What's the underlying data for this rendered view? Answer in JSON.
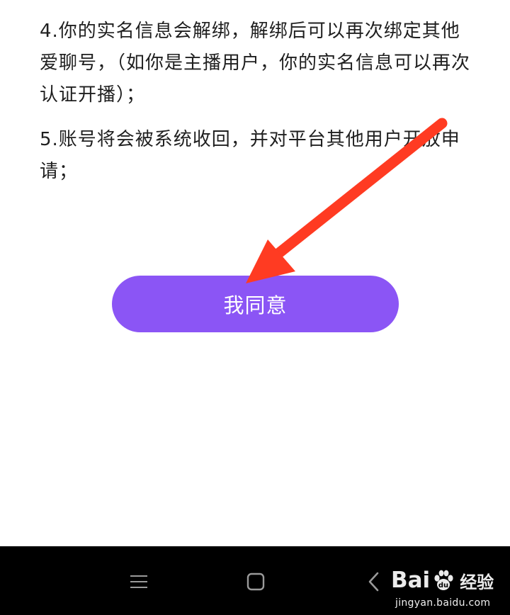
{
  "terms": {
    "item4": "4.你的实名信息会解绑，解绑后可以再次绑定其他爱聊号，（如你是主播用户，你的实名信息可以再次认证开播）；",
    "item5": "5.账号将会被系统收回，并对平台其他用户开放申请；"
  },
  "agree_button": {
    "label": "我同意",
    "color": "#8b55f5"
  },
  "annotation_arrow": {
    "color": "#ff3b22"
  },
  "navbar": {
    "menu_icon": "menu-icon",
    "home_icon": "home-square-icon",
    "back_icon": "back-chevron-icon"
  },
  "watermark": {
    "brand": "Bai du",
    "brand_cn": "经验",
    "url": "jingyan.baidu.com"
  }
}
